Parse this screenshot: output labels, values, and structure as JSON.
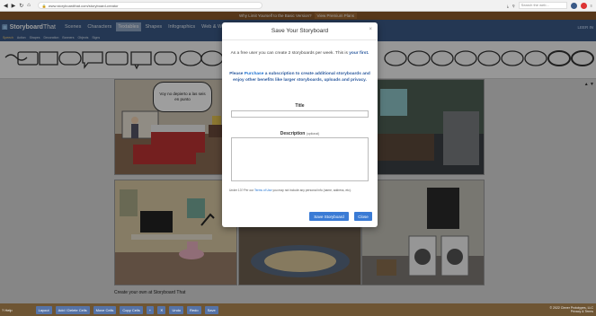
{
  "browser": {
    "url": "www.storyboardthat.com/storyboard-creator",
    "search_placeholder": "Search the web..."
  },
  "promo": {
    "text": "Why Limit Yourself to the Basic Version?",
    "upgrade": "View Premium Plans"
  },
  "app": {
    "logo_main": "Storyboard",
    "logo_sub": "That",
    "tabs": [
      "Scenes",
      "Characters",
      "Textables",
      "Shapes",
      "Infographics",
      "Web & Wireframes"
    ],
    "active_tab_index": 2,
    "header_right": "LEER IN",
    "sub_tabs": [
      "Speech",
      "Action",
      "Shapes",
      "Decoration",
      "Banners",
      "Objects",
      "Signs"
    ],
    "active_sub_tab_index": 0
  },
  "storyboard": {
    "speech_text": "Voy no depierto a las seis en punto",
    "caption": "Create your own at Storyboard That"
  },
  "modal": {
    "title": "Save Your Storyboard",
    "limit_text_pre": "As a free user you can create 2 storyboards per week. This is",
    "limit_text_em": "your first.",
    "purchase_pre": "Please",
    "purchase_link": "Purchase",
    "purchase_post": "a subscription to create additional storyboards and enjoy other benefits like larger storyboards, uploads and privacy.",
    "title_label": "Title",
    "title_value": "",
    "description_label": "Description",
    "description_optional": "(optional)",
    "description_value": "",
    "terms_pre": "Under 13? Per our",
    "terms_link": "Terms of Use",
    "terms_post": "you may not include any personal info (name, address, etc).",
    "save_button": "Save Storyboard",
    "close_button": "Close"
  },
  "bottom": {
    "help": "Help",
    "buttons": [
      "Layout",
      "Add / Delete Cells",
      "Move Cells",
      "Copy Cells",
      "Undo",
      "Redo",
      "Save"
    ],
    "copyright_line1": "© 2022 Clever Prototypes, LLC",
    "copyright_line2": "Privacy & Terms"
  },
  "colors": {
    "header": "#3a5a87",
    "promo": "#8b5a2b",
    "bottom": "#6e5533",
    "primary_button": "#3a7bd5"
  }
}
